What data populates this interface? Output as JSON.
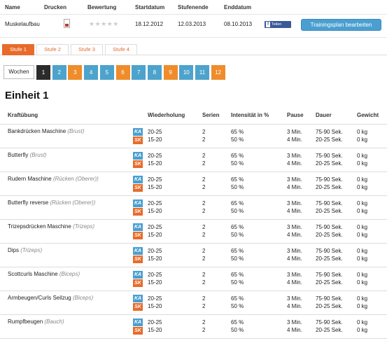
{
  "plan": {
    "headers": [
      "Name",
      "Drucken",
      "Bewertung",
      "Startdatum",
      "Stufenende",
      "Enddatum"
    ],
    "name": "Muskelaufbau",
    "rating": "★★★★★",
    "start": "18.12.2012",
    "stage_end": "12.03.2013",
    "end": "08.10.2013",
    "share_label": "Teilen",
    "share_icon": "f",
    "edit_label": "Trainingsplan bearbeiten"
  },
  "stages": [
    "Stufe 1",
    "Stufe 2",
    "Stufe 3",
    "Stufe 4"
  ],
  "weeks_label": "Wochen",
  "weeks": [
    {
      "label": "1",
      "color": "#2b2b2b"
    },
    {
      "label": "2",
      "color": "#4da3cc"
    },
    {
      "label": "3",
      "color": "#ef8c2c"
    },
    {
      "label": "4",
      "color": "#4da3cc"
    },
    {
      "label": "5",
      "color": "#4da3cc"
    },
    {
      "label": "6",
      "color": "#ef8c2c"
    },
    {
      "label": "7",
      "color": "#4da3cc"
    },
    {
      "label": "8",
      "color": "#4da3cc"
    },
    {
      "label": "9",
      "color": "#ef8c2c"
    },
    {
      "label": "10",
      "color": "#4da3cc"
    },
    {
      "label": "11",
      "color": "#4da3cc"
    },
    {
      "label": "12",
      "color": "#ef8c2c"
    }
  ],
  "unit_title": "Einheit 1",
  "table_headers": [
    "Kraftübung",
    "Wiederholung",
    "Serien",
    "Intensität in %",
    "Pause",
    "Dauer",
    "Gewicht"
  ],
  "badge_ka": "KA",
  "badge_sk": "SK",
  "exercises": [
    {
      "name": "Bankdrücken Maschine",
      "muscle": "(Brust)",
      "reps": [
        "20-25",
        "15-20"
      ],
      "sets": [
        "2",
        "2"
      ],
      "intensity": [
        "65 %",
        "50 %"
      ],
      "pause": [
        "3 Min.",
        "4 Min."
      ],
      "duration": [
        "75-90 Sek.",
        "20-25 Sek."
      ],
      "weight": [
        "0 kg",
        "0 kg"
      ]
    },
    {
      "name": "Butterfly",
      "muscle": "(Brust)",
      "reps": [
        "20-25",
        "15-20"
      ],
      "sets": [
        "2",
        "2"
      ],
      "intensity": [
        "65 %",
        "50 %"
      ],
      "pause": [
        "3 Min.",
        "4 Min."
      ],
      "duration": [
        "75-90 Sek.",
        "20-25 Sek."
      ],
      "weight": [
        "0 kg",
        "0 kg"
      ]
    },
    {
      "name": "Rudern Maschine",
      "muscle": "(Rücken (Oberer))",
      "reps": [
        "20-25",
        "15-20"
      ],
      "sets": [
        "2",
        "2"
      ],
      "intensity": [
        "65 %",
        "50 %"
      ],
      "pause": [
        "3 Min.",
        "4 Min."
      ],
      "duration": [
        "75-90 Sek.",
        "20-25 Sek."
      ],
      "weight": [
        "0 kg",
        "0 kg"
      ]
    },
    {
      "name": "Butterfly reverse",
      "muscle": "(Rücken (Oberer))",
      "reps": [
        "20-25",
        "15-20"
      ],
      "sets": [
        "2",
        "2"
      ],
      "intensity": [
        "65 %",
        "50 %"
      ],
      "pause": [
        "3 Min.",
        "4 Min."
      ],
      "duration": [
        "75-90 Sek.",
        "20-25 Sek."
      ],
      "weight": [
        "0 kg",
        "0 kg"
      ]
    },
    {
      "name": "Trizepsdrücken Maschine",
      "muscle": "(Trizeps)",
      "reps": [
        "20-25",
        "15-20"
      ],
      "sets": [
        "2",
        "2"
      ],
      "intensity": [
        "65 %",
        "50 %"
      ],
      "pause": [
        "3 Min.",
        "4 Min."
      ],
      "duration": [
        "75-90 Sek.",
        "20-25 Sek."
      ],
      "weight": [
        "0 kg",
        "0 kg"
      ]
    },
    {
      "name": "Dips",
      "muscle": "(Trizeps)",
      "reps": [
        "20-25",
        "15-20"
      ],
      "sets": [
        "2",
        "2"
      ],
      "intensity": [
        "65 %",
        "50 %"
      ],
      "pause": [
        "3 Min.",
        "4 Min."
      ],
      "duration": [
        "75-90 Sek.",
        "20-25 Sek."
      ],
      "weight": [
        "0 kg",
        "0 kg"
      ]
    },
    {
      "name": "Scottcurls Maschine",
      "muscle": "(Biceps)",
      "reps": [
        "20-25",
        "15-20"
      ],
      "sets": [
        "2",
        "2"
      ],
      "intensity": [
        "65 %",
        "50 %"
      ],
      "pause": [
        "3 Min.",
        "4 Min."
      ],
      "duration": [
        "75-90 Sek.",
        "20-25 Sek."
      ],
      "weight": [
        "0 kg",
        "0 kg"
      ]
    },
    {
      "name": "Armbeugen/Curls Seilzug",
      "muscle": "(Biceps)",
      "reps": [
        "20-25",
        "15-20"
      ],
      "sets": [
        "2",
        "2"
      ],
      "intensity": [
        "65 %",
        "50 %"
      ],
      "pause": [
        "3 Min.",
        "4 Min."
      ],
      "duration": [
        "75-90 Sek.",
        "20-25 Sek."
      ],
      "weight": [
        "0 kg",
        "0 kg"
      ]
    },
    {
      "name": "Rumpfbeugen",
      "muscle": "(Bauch)",
      "reps": [
        "20-25",
        "15-20"
      ],
      "sets": [
        "2",
        "2"
      ],
      "intensity": [
        "65 %",
        "50 %"
      ],
      "pause": [
        "3 Min.",
        "4 Min."
      ],
      "duration": [
        "75-90 Sek.",
        "20-25 Sek."
      ],
      "weight": [
        "0 kg",
        "0 kg"
      ]
    }
  ]
}
